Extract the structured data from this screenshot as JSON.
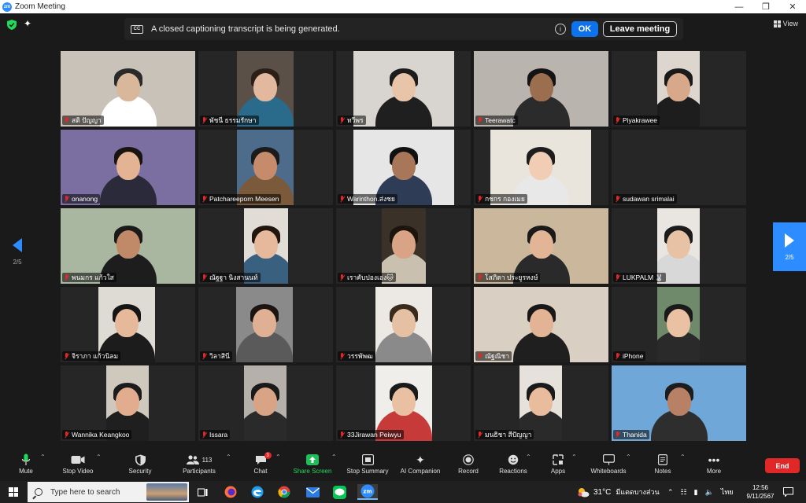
{
  "window": {
    "title": "Zoom Meeting"
  },
  "banner": {
    "cc_label": "CC",
    "message": "A closed captioning transcript is being generated.",
    "ok_label": "OK",
    "leave_label": "Leave meeting"
  },
  "view_label": "View",
  "pager": {
    "left": "2/5",
    "right": "2/5"
  },
  "participants": [
    {
      "name": "สติ ปัญญา"
    },
    {
      "name": "พัชนี ธรรมรักษา"
    },
    {
      "name": "ทวีพร"
    },
    {
      "name": "Teerawatc"
    },
    {
      "name": "Piyakrawee"
    },
    {
      "name": "onanong"
    },
    {
      "name": "Patchareeporn Meesen"
    },
    {
      "name": "Warinthon.ส่งชย"
    },
    {
      "name": "กชกร กองเมย"
    },
    {
      "name": "sudawan srimalai"
    },
    {
      "name": "พนมกร แก้วใส"
    },
    {
      "name": "ณัฐฐา นิงสานนท์"
    },
    {
      "name": "เราคับปองเอง🐱"
    },
    {
      "name": "โสภิดา ประยูรหงษ์"
    },
    {
      "name": "LUKPALM 🐰"
    },
    {
      "name": "จิราภา แก้วนิลม"
    },
    {
      "name": "วิลาสินี"
    },
    {
      "name": "วรรพัพฒ"
    },
    {
      "name": "ณัฐณิชา"
    },
    {
      "name": "iPhone"
    },
    {
      "name": "Wannika Keangkoo"
    },
    {
      "name": "Issara"
    },
    {
      "name": "33Jirawan Peiwyu"
    },
    {
      "name": "มนธิชา สีปัญญา"
    },
    {
      "name": "Thanida"
    }
  ],
  "toolbar": {
    "mute": "Mute",
    "stop_video": "Stop Video",
    "security": "Security",
    "participants": "Participants",
    "participants_count": "113",
    "chat": "Chat",
    "chat_badge": "3",
    "share_screen": "Share Screen",
    "stop_summary": "Stop Summary",
    "ai_companion": "AI Companion",
    "record": "Record",
    "reactions": "Reactions",
    "apps": "Apps",
    "whiteboards": "Whiteboards",
    "notes": "Notes",
    "more": "More",
    "end": "End"
  },
  "taskbar": {
    "search_placeholder": "Type here to search",
    "temperature": "31°C",
    "weather": "มีแดดบางส่วน",
    "language": "ไทย",
    "time": "12:56",
    "date": "9/11/2567"
  },
  "colors": {
    "accent": "#2d8cff",
    "ok_button": "#0e72ed",
    "danger": "#e02828",
    "share_green": "#1fbe5b"
  }
}
